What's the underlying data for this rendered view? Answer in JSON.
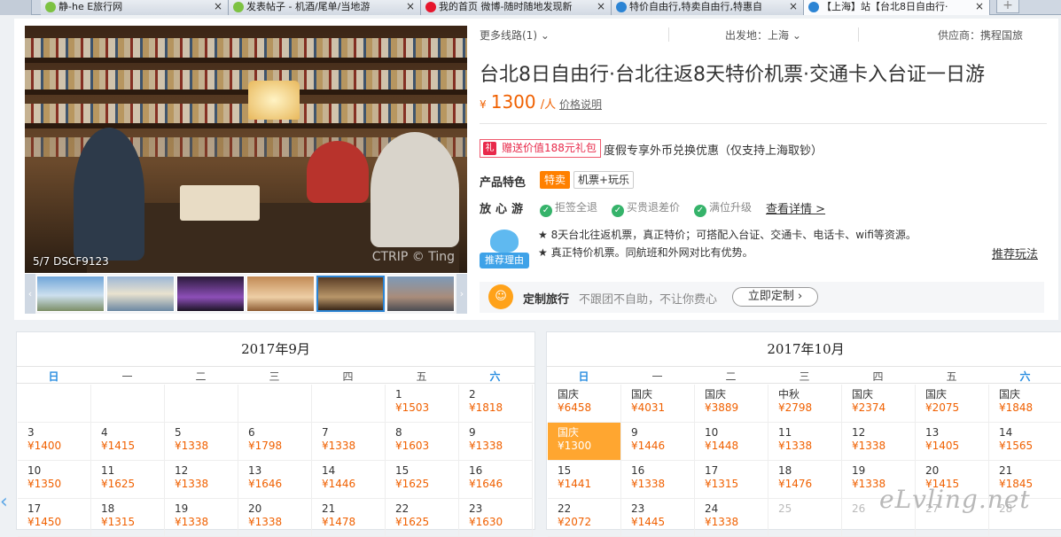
{
  "tabs": [
    {
      "label": "静-he E旅行网",
      "active": false,
      "color": "#7dc242"
    },
    {
      "label": "发表帖子 - 机酒/尾单/当地游",
      "active": false,
      "color": "#7dc242"
    },
    {
      "label": "我的首页 微博-随时随地发现新",
      "active": false,
      "color": "#e6162d"
    },
    {
      "label": "特价自由行,特卖自由行,特惠自",
      "active": false,
      "color": "#2b84d4"
    },
    {
      "label": "【上海】站【台北8日自由行·",
      "active": true,
      "color": "#2b84d4"
    }
  ],
  "newtab_label": "+",
  "photo": {
    "caption": "5/7 DSCF9123",
    "watermark": "CTRIP © Ting"
  },
  "topbar": {
    "more_routes": "更多线路(1)",
    "departure": "出发地：上海",
    "supplier": "供应商：携程国旅"
  },
  "product": {
    "title": "台北8日自由行·台北往返8天特价机票·交通卡入台证一日游",
    "currency": "¥",
    "price": "1300",
    "per": "/人",
    "price_note": "价格说明",
    "gift_label": "赠送价值188元礼包",
    "gift_desc": "度假专享外币兑换优惠（仅支持上海取钞）",
    "features_label": "产品特色",
    "tag_special": "特卖",
    "tag_type": "机票+玩乐",
    "assure_label": "放心游",
    "assures": [
      "拒签全退",
      "买贵退差价",
      "满位升级"
    ],
    "detail_link": "查看详情 >",
    "reason_badge": "推荐理由",
    "reasons": [
      "★ 8天台北往返机票，真正特价；可搭配入台证、交通卡、电话卡、wifi等资源。",
      "★ 真正特价机票。同航班和外网对比有优势。"
    ],
    "suggest_link": "推荐玩法"
  },
  "custom": {
    "title": "定制旅行",
    "desc": "不跟团不自助，不让你费心",
    "button": "立即定制 ›"
  },
  "weekdays": [
    "日",
    "一",
    "二",
    "三",
    "四",
    "五",
    "六"
  ],
  "calendars": [
    {
      "month": "2017年9月",
      "rows": [
        [
          null,
          null,
          null,
          null,
          null,
          {
            "d": "1",
            "p": "¥1503"
          },
          {
            "d": "2",
            "p": "¥1818"
          }
        ],
        [
          {
            "d": "3",
            "p": "¥1400"
          },
          {
            "d": "4",
            "p": "¥1415"
          },
          {
            "d": "5",
            "p": "¥1338"
          },
          {
            "d": "6",
            "p": "¥1798"
          },
          {
            "d": "7",
            "p": "¥1338"
          },
          {
            "d": "8",
            "p": "¥1603"
          },
          {
            "d": "9",
            "p": "¥1338"
          }
        ],
        [
          {
            "d": "10",
            "p": "¥1350"
          },
          {
            "d": "11",
            "p": "¥1625"
          },
          {
            "d": "12",
            "p": "¥1338"
          },
          {
            "d": "13",
            "p": "¥1646"
          },
          {
            "d": "14",
            "p": "¥1446"
          },
          {
            "d": "15",
            "p": "¥1625"
          },
          {
            "d": "16",
            "p": "¥1646"
          }
        ],
        [
          {
            "d": "17",
            "p": "¥1450"
          },
          {
            "d": "18",
            "p": "¥1315"
          },
          {
            "d": "19",
            "p": "¥1338"
          },
          {
            "d": "20",
            "p": "¥1338"
          },
          {
            "d": "21",
            "p": "¥1478"
          },
          {
            "d": "22",
            "p": "¥1625"
          },
          {
            "d": "23",
            "p": "¥1630"
          }
        ]
      ]
    },
    {
      "month": "2017年10月",
      "rows": [
        [
          {
            "d": "国庆",
            "p": "¥6458"
          },
          {
            "d": "国庆",
            "p": "¥4031"
          },
          {
            "d": "国庆",
            "p": "¥3889"
          },
          {
            "d": "中秋",
            "p": "¥2798"
          },
          {
            "d": "国庆",
            "p": "¥2374"
          },
          {
            "d": "国庆",
            "p": "¥2075"
          },
          {
            "d": "国庆",
            "p": "¥1848"
          }
        ],
        [
          {
            "d": "国庆",
            "p": "¥1300",
            "sel": true
          },
          {
            "d": "9",
            "p": "¥1446"
          },
          {
            "d": "10",
            "p": "¥1448"
          },
          {
            "d": "11",
            "p": "¥1338"
          },
          {
            "d": "12",
            "p": "¥1338"
          },
          {
            "d": "13",
            "p": "¥1405"
          },
          {
            "d": "14",
            "p": "¥1565"
          }
        ],
        [
          {
            "d": "15",
            "p": "¥1441"
          },
          {
            "d": "16",
            "p": "¥1338"
          },
          {
            "d": "17",
            "p": "¥1315"
          },
          {
            "d": "18",
            "p": "¥1476"
          },
          {
            "d": "19",
            "p": "¥1338"
          },
          {
            "d": "20",
            "p": "¥1415"
          },
          {
            "d": "21",
            "p": "¥1845"
          }
        ],
        [
          {
            "d": "22",
            "p": "¥2072"
          },
          {
            "d": "23",
            "p": "¥1445"
          },
          {
            "d": "24",
            "p": "¥1338"
          },
          {
            "d": "25",
            "p": "",
            "off": true
          },
          {
            "d": "26",
            "p": "",
            "off": true
          },
          {
            "d": "27",
            "p": "",
            "off": true
          },
          {
            "d": "28",
            "p": "",
            "off": true
          }
        ]
      ]
    }
  ],
  "watermark": "eLvling.net"
}
